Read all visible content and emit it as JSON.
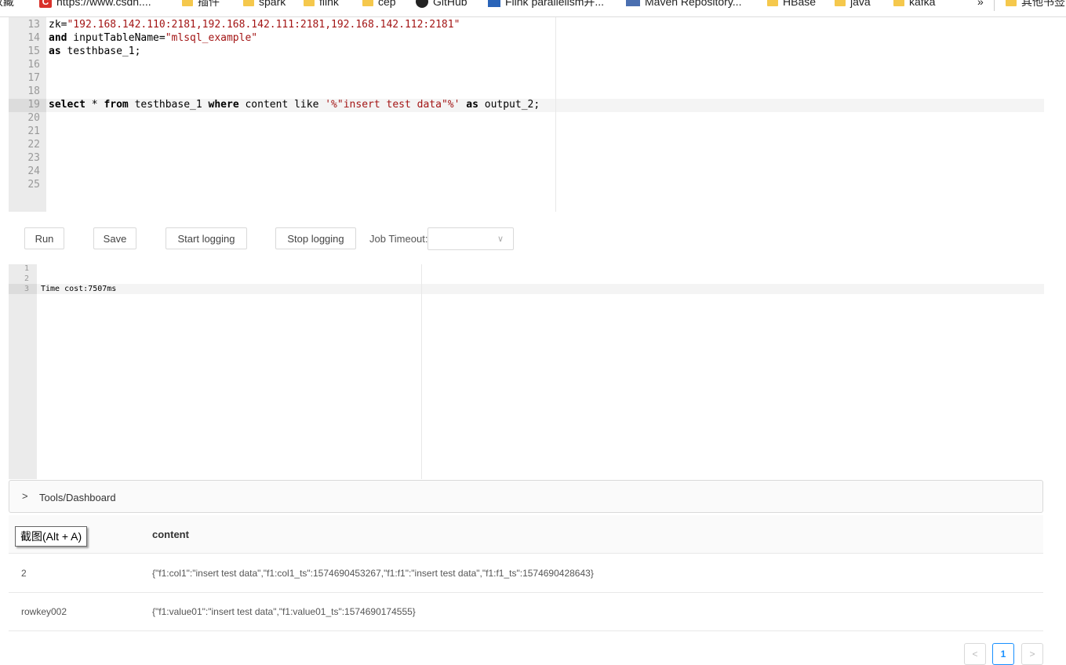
{
  "bookmarks": [
    {
      "icon": "text-fragment",
      "label": "收藏"
    },
    {
      "icon": "csdn-icon",
      "label": "https://www.csdn...."
    },
    {
      "icon": "folder-icon",
      "label": "插件"
    },
    {
      "icon": "folder-icon",
      "label": "spark"
    },
    {
      "icon": "folder-icon",
      "label": "flink"
    },
    {
      "icon": "folder-icon",
      "label": "cep"
    },
    {
      "icon": "github-icon",
      "label": "GitHub"
    },
    {
      "icon": "blog-icon",
      "label": "Flink parallelism并..."
    },
    {
      "icon": "maven-icon",
      "label": "Maven Repository..."
    },
    {
      "icon": "folder-icon",
      "label": "HBase"
    },
    {
      "icon": "folder-icon",
      "label": "java"
    },
    {
      "icon": "folder-icon",
      "label": "kafka"
    }
  ],
  "bookmarks_more": "»",
  "bookmarks_other": "其他书签",
  "editor": {
    "line_numbers": [
      "13",
      "14",
      "15",
      "16",
      "17",
      "18",
      "19",
      "20",
      "21",
      "22",
      "23",
      "24",
      "25"
    ],
    "line13": {
      "a": "zk=",
      "b": "\"192.168.142.110:2181,192.168.142.111:2181,192.168.142.112:2181\""
    },
    "line14": {
      "kw": "and",
      "a": " inputTableName=",
      "b": "\"mlsql_example\""
    },
    "line15": {
      "kw": "as",
      "a": " testhbase_1;"
    },
    "line19": {
      "kw1": "select",
      "a": " * ",
      "kw2": "from",
      "b": " testhbase_1 ",
      "kw3": "where",
      "c": " content like ",
      "s1": "'%",
      "s2": "\"insert test data\"",
      "s3": "%'",
      "d": " ",
      "kw4": "as",
      "e": " output_2;"
    }
  },
  "toolbar": {
    "run": "Run",
    "save": "Save",
    "start_logging": "Start logging",
    "stop_logging": "Stop logging",
    "timeout_label": "Job Timeout:",
    "timeout_value": ""
  },
  "log": {
    "line_numbers": [
      "1",
      "2",
      "3"
    ],
    "line3": "Time cost:7507ms"
  },
  "collapse": {
    "title": "Tools/Dashboard"
  },
  "table": {
    "tooltip": "截图(Alt + A)",
    "column_content": "content",
    "rows": [
      {
        "key": "2",
        "content": "{\"f1:col1\":\"insert test data\",\"f1:col1_ts\":1574690453267,\"f1:f1\":\"insert test data\",\"f1:f1_ts\":1574690428643}"
      },
      {
        "key": "rowkey002",
        "content": "{\"f1:value01\":\"insert test data\",\"f1:value01_ts\":1574690174555}"
      }
    ]
  },
  "pagination": {
    "prev": "<",
    "current": "1",
    "next": ">"
  }
}
